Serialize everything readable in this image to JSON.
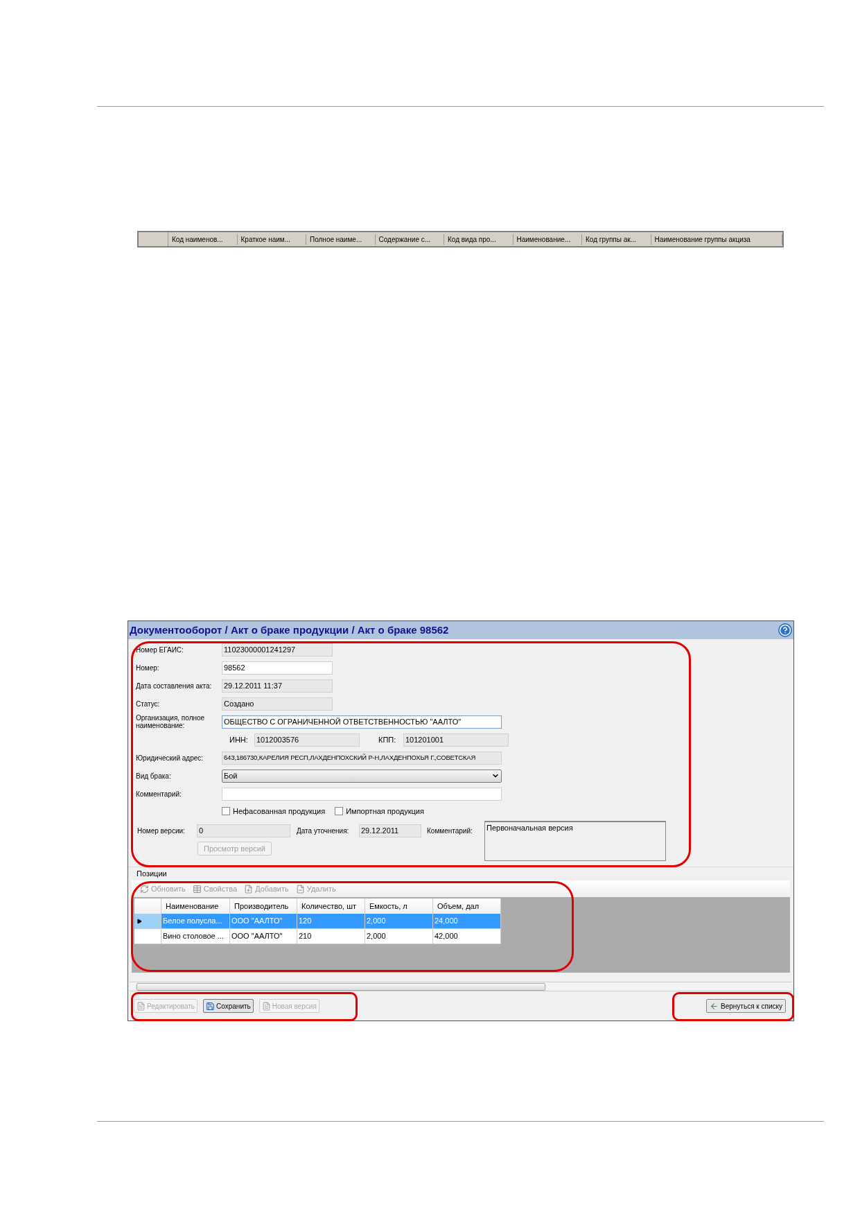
{
  "column_header_strip": {
    "columns": [
      "Код наименов...",
      "Краткое наим...",
      "Полное наиме...",
      "Содержание с...",
      "Код вида про...",
      "Наименование...",
      "Код группы ак...",
      "Наименование группы акциза"
    ]
  },
  "window": {
    "title": "Документооборот / Акт о браке продукции / Акт о браке 98562",
    "form": [
      {
        "kind": "readonly",
        "label": "Номер ЕГАИС:",
        "value": "11023000001241297"
      },
      {
        "kind": "input",
        "label": "Номер:",
        "value": "98562"
      },
      {
        "kind": "readonly",
        "label": "Дата составления акта:",
        "value": "29.12.2011 11:37"
      },
      {
        "kind": "readonly",
        "label": "Статус:",
        "value": "Создано"
      },
      {
        "kind": "active",
        "label": "Организация, полное наименование:",
        "value": "ОБЩЕСТВО С ОГРАНИЧЕННОЙ ОТВЕТСТВЕННОСТЬЮ \"ААЛТО\""
      },
      {
        "kind": "pair",
        "fields": [
          {
            "label": "ИНН:",
            "value": "1012003576"
          },
          {
            "label": "КПП:",
            "value": "101201001"
          }
        ]
      },
      {
        "kind": "readonly",
        "label": "Юридический адрес:",
        "value": "643,186730,КАРЕЛИЯ РЕСП,ЛАХДЕНПОХСКИЙ Р-Н,ЛАХДЕНПОХЬЯ Г.,СОВЕТСКАЯ"
      },
      {
        "kind": "select",
        "label": "Вид брака:",
        "value": "Бой"
      },
      {
        "kind": "input",
        "label": "Комментарий:"
      }
    ],
    "checkboxes": [
      {
        "label": "Нефасованная продукция",
        "checked": false
      },
      {
        "label": "Импортная продукция",
        "checked": false
      }
    ],
    "version": {
      "number_label": "Номер версии:",
      "number": "0",
      "date_label": "Дата уточнения:",
      "date": "29.12.2011",
      "comment_label": "Комментарий:",
      "comment": "Первоначальная версия",
      "button": {
        "label": "Просмотр версий",
        "disabled": true
      }
    },
    "positions": {
      "title": "Позиции",
      "toolbar": [
        {
          "kind": "refresh",
          "label": "Обновить",
          "disabled": true
        },
        {
          "kind": "properties",
          "label": "Свойства",
          "disabled": true
        },
        {
          "kind": "add",
          "label": "Добавить",
          "disabled": true
        },
        {
          "kind": "delete",
          "label": "Удалить",
          "disabled": true
        }
      ],
      "columns": [
        "Наименование",
        "Производитель",
        "Количество, шт",
        "Емкость, л",
        "Объем, дал"
      ],
      "rows": [
        {
          "selected": true,
          "cells": [
            "Белое полусла...",
            "ООО \"ААЛТО\"",
            "120",
            "2,000",
            "24,000"
          ]
        },
        {
          "selected": false,
          "cells": [
            "Вино столовое ...",
            "ООО \"ААЛТО\"",
            "210",
            "2,000",
            "42,000"
          ]
        }
      ]
    },
    "footer_buttons": [
      {
        "label": "Редактировать",
        "disabled": true
      },
      {
        "label": "Сохранить",
        "disabled": false
      },
      {
        "label": "Новая версия",
        "disabled": true
      }
    ],
    "back_button": {
      "label": "Вернуться к списку"
    }
  }
}
